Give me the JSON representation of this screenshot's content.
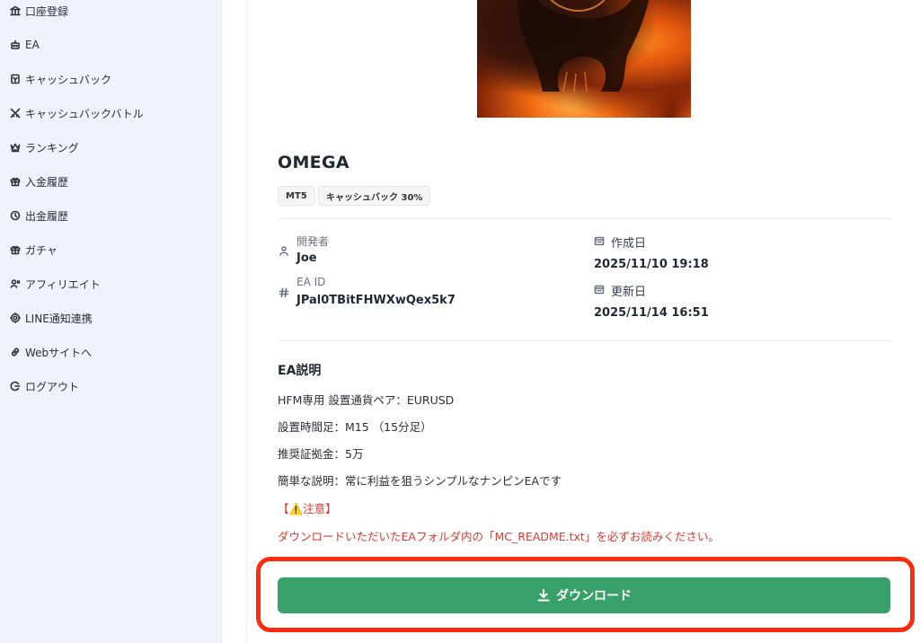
{
  "sidebar": {
    "items": [
      {
        "icon": "bank-icon",
        "label": "口座登録"
      },
      {
        "icon": "robot-icon",
        "label": "EA"
      },
      {
        "icon": "receipt-icon",
        "label": "キャッシュバック"
      },
      {
        "icon": "swords-icon",
        "label": "キャッシュバックバトル"
      },
      {
        "icon": "crown-icon",
        "label": "ランキング"
      },
      {
        "icon": "gift-icon",
        "label": "入金履歴"
      },
      {
        "icon": "clock-icon",
        "label": "出金履歴"
      },
      {
        "icon": "gift-icon",
        "label": "ガチャ"
      },
      {
        "icon": "affiliate-icon",
        "label": "アフィリエイト"
      },
      {
        "icon": "gear-icon",
        "label": "LINE通知連携"
      },
      {
        "icon": "link-icon",
        "label": "Webサイトへ"
      },
      {
        "icon": "logout-icon",
        "label": "ログアウト"
      }
    ]
  },
  "ea": {
    "name": "OMEGA",
    "badges": [
      "MT5",
      "キャッシュバック 30%"
    ],
    "developer_label": "開発者",
    "developer": "Joe",
    "id_label": "EA ID",
    "id": "JPal0TBitFHWXwQex5k7",
    "created_label": "作成日",
    "created": "2025/11/10 19:18",
    "updated_label": "更新日",
    "updated": "2025/11/14 16:51"
  },
  "description": {
    "title": "EA説明",
    "lines": [
      "HFM専用 設置通貨ペア：EURUSD",
      "設置時間足：M15 （15分足）",
      "推奨証拠金：5万",
      "簡単な説明：常に利益を狙うシンプルなナンピンEAです"
    ],
    "warning_title": "【⚠️注意】",
    "warning_text": "ダウンロードいただいたEAフォルダ内の「MC_README.txt」を必ずお読みください。"
  },
  "download_label": "ダウンロード",
  "colors": {
    "accent": "#38a169",
    "warning": "#dc3b2f",
    "highlight": "#ff2a10"
  }
}
